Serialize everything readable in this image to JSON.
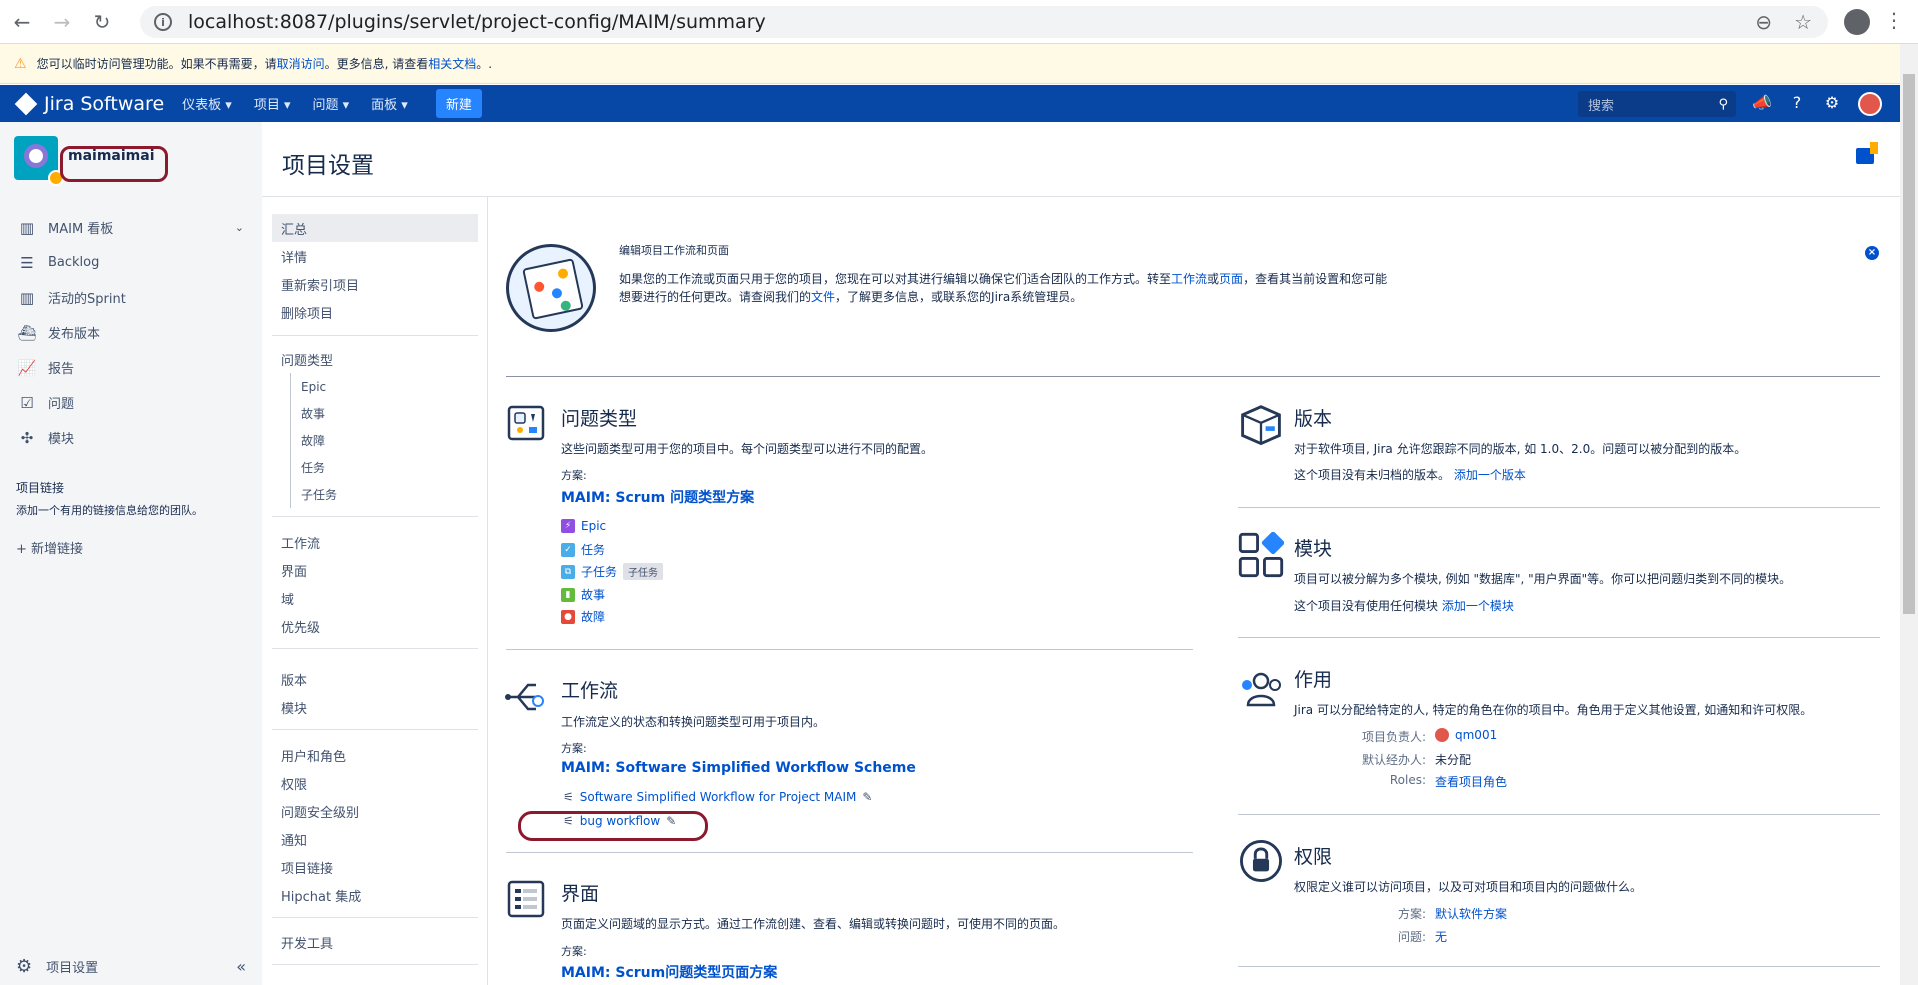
{
  "browser": {
    "url": "localhost:8087/plugins/servlet/project-config/MAIM/summary",
    "back_icon": "←",
    "forward_icon": "→",
    "reload_icon": "↻",
    "info_icon": "i",
    "zoom_icon": "⊖",
    "star_icon": "☆",
    "menu_icon": "⋮"
  },
  "notice": {
    "text_prefix": "您可以临时访问管理功能。如果不再需要，请 ",
    "link1": "取消访问",
    "text_mid": "。更多信息, 请查看 ",
    "link2": "相关文档",
    "text_suffix": "。.",
    "icon": "⚠"
  },
  "topnav": {
    "logo": "Jira Software",
    "menu": [
      "仪表板 ▾",
      "项目 ▾",
      "问题 ▾",
      "面板 ▾"
    ],
    "create": "新建",
    "search_placeholder": "搜索",
    "search_icon": "⚲",
    "icons": [
      "📣",
      "?",
      "⚙"
    ],
    "accent": "#0747a6"
  },
  "sidebar": {
    "project_name": "maimaimai",
    "items": [
      {
        "icon": "▥",
        "label": "MAIM 看板",
        "chevron": "⌄"
      },
      {
        "icon": "☰",
        "label": "Backlog"
      },
      {
        "icon": "▥",
        "label": "活动的Sprint"
      },
      {
        "icon": "⛴",
        "label": "发布版本"
      },
      {
        "icon": "📈",
        "label": "报告"
      },
      {
        "icon": "☑",
        "label": "问题"
      },
      {
        "icon": "✣",
        "label": "模块"
      }
    ],
    "project_links_title": "项目链接",
    "project_links_desc": "添加一个有用的链接信息给您的团队。",
    "add_link": "+ 新增链接",
    "settings_label": "项目设置",
    "collapse_icon": "«",
    "gear_icon": "⚙"
  },
  "page": {
    "title": "项目设置"
  },
  "config_nav": {
    "group1": [
      "汇总",
      "详情",
      "重新索引项目",
      "删除项目"
    ],
    "group2_title": "问题类型",
    "group2_sub": [
      "Epic",
      "故事",
      "故障",
      "任务",
      "子任务"
    ],
    "group3": [
      "工作流",
      "界面",
      "域",
      "优先级"
    ],
    "group4": [
      "版本",
      "模块"
    ],
    "group5": [
      "用户和角色",
      "权限",
      "问题安全级别",
      "通知",
      "项目链接",
      "Hipchat 集成"
    ],
    "group6": [
      "开发工具"
    ]
  },
  "banner": {
    "title": "编辑项目工作流和页面",
    "text1_prefix": "如果您的工作流或页面只用于您的项目，您现在可以对其进行编辑以确保它们适合团队的工作方式。转至",
    "link_workflow": "工作流",
    "text1_or": "或",
    "link_screen": "页面",
    "text1_suffix": "，查看其当前设置和您可能",
    "text2_prefix": "想要进行的任何更改。请查阅我们的",
    "link_docs": "文件",
    "text2_suffix": "，了解更多信息，或联系您的Jira系统管理员。",
    "close_icon": "×"
  },
  "issue_types": {
    "title": "问题类型",
    "desc": "这些问题类型可用于您的项目中。每个问题类型可以进行不同的配置。",
    "scheme_label": "方案:",
    "scheme": "MAIM: Scrum 问题类型方案",
    "types": [
      {
        "label": "Epic",
        "color": "#904ee2",
        "glyph": "⚡"
      },
      {
        "label": "任务",
        "color": "#4bade8",
        "glyph": "✓"
      },
      {
        "label": "子任务",
        "color": "#4bade8",
        "glyph": "⧉",
        "tag": "子任务"
      },
      {
        "label": "故事",
        "color": "#63ba3c",
        "glyph": "▮"
      },
      {
        "label": "故障",
        "color": "#e5493a",
        "glyph": "●"
      }
    ]
  },
  "workflow": {
    "title": "工作流",
    "desc": "工作流定义的状态和转换问题类型可用于项目内。",
    "scheme_label": "方案:",
    "scheme": "MAIM: Software Simplified Workflow Scheme",
    "items": [
      {
        "label": "Software Simplified Workflow for Project MAIM"
      },
      {
        "label": "bug workflow"
      }
    ],
    "wf_icon": "⚟",
    "edit_icon": "✎"
  },
  "screens": {
    "title": "界面",
    "desc": "页面定义问题域的显示方式。通过工作流创建、查看、编辑或转换问题时，可使用不同的页面。",
    "scheme_label": "方案:",
    "scheme": "MAIM: Scrum问题类型页面方案"
  },
  "versions": {
    "title": "版本",
    "desc": "对于软件项目, Jira 允许您跟踪不同的版本, 如 1.0、2.0。问题可以被分配到的版本。",
    "empty_prefix": "这个项目没有未归档的版本。",
    "add": "添加一个版本"
  },
  "components": {
    "title": "模块",
    "desc": "项目可以被分解为多个模块, 例如 \"数据库\", \"用户界面\"等。你可以把问题归类到不同的模块。",
    "empty_prefix": "这个项目没有使用任何模块 ",
    "add": "添加一个模块"
  },
  "roles": {
    "title": "作用",
    "desc": "Jira 可以分配给特定的人, 特定的角色在你的项目中。角色用于定义其他设置, 如通知和许可权限。",
    "lead_label": "项目负责人:",
    "lead_value": "qm001",
    "assignee_label": "默认经办人:",
    "assignee_value": "未分配",
    "roles_label": "Roles:",
    "roles_value": "查看项目角色"
  },
  "permissions": {
    "title": "权限",
    "desc": "权限定义谁可以访问项目，以及可对项目和项目内的问题做什么。",
    "scheme_label": "方案:",
    "scheme_value": "默认软件方案",
    "issue_label": "问题:",
    "issue_value": "无"
  }
}
